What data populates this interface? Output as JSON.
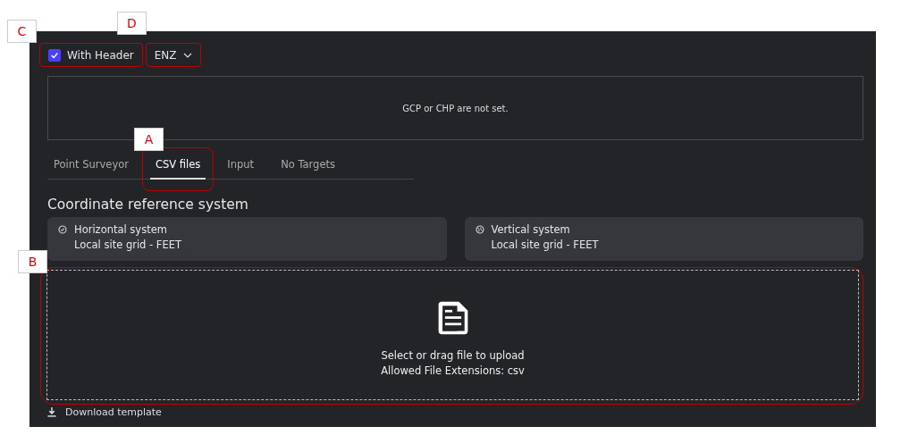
{
  "header_checkbox": {
    "label": "With Header",
    "checked": true,
    "highlighted": true
  },
  "axis_dropdown": {
    "value": "ENZ",
    "highlighted": true
  },
  "message": "GCP or CHP are not set.",
  "tabs": [
    {
      "label": "Point Surveyor",
      "selected": false,
      "highlighted": false
    },
    {
      "label": "CSV files",
      "selected": true,
      "highlighted": true
    },
    {
      "label": "Input",
      "selected": false,
      "highlighted": false
    },
    {
      "label": "No Targets",
      "selected": false,
      "highlighted": false
    }
  ],
  "section_title": "Coordinate reference system",
  "systems": [
    {
      "kind": "horizontal",
      "title": "Horizontal system",
      "value": "Local site grid - FEET"
    },
    {
      "kind": "vertical",
      "title": "Vertical system",
      "value": "Local site grid - FEET"
    }
  ],
  "dropzone": {
    "line_1": "Select or drag file to upload",
    "line_2": "Allowed File Extensions: csv",
    "highlighted": true
  },
  "download_link": "Download template",
  "callouts": [
    {
      "label": "C"
    },
    {
      "label": "D"
    },
    {
      "label": "A"
    },
    {
      "label": "B"
    }
  ]
}
